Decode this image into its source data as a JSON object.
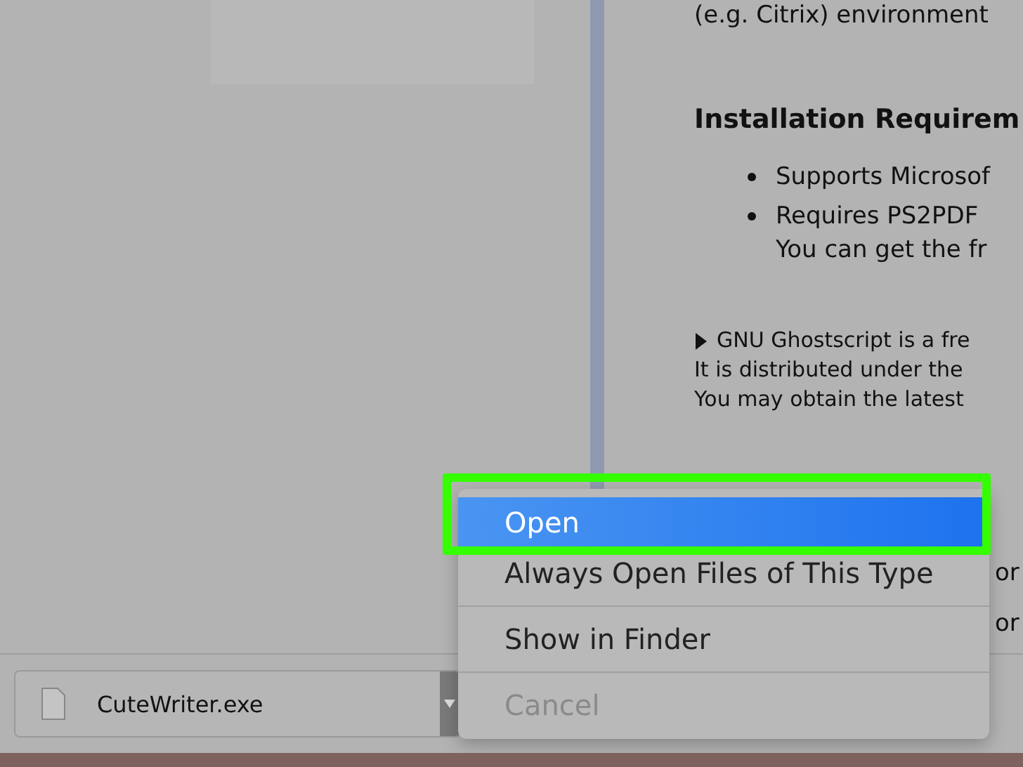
{
  "document": {
    "paragraphs": [
      {
        "kind": "text",
        "text": "(e.g. Citrix) environment"
      },
      {
        "kind": "heading",
        "text": "Installation Requirem"
      },
      {
        "kind": "bullet",
        "text": "Supports Microsof"
      },
      {
        "kind": "bullet",
        "text": "Requires PS2PDF",
        "more": "You can get the fr"
      },
      {
        "kind": "note",
        "text": "GNU Ghostscript is a fre",
        "lines": [
          "It is distributed under the",
          "You may obtain the latest"
        ]
      }
    ],
    "side_fragments": [
      "or",
      "or"
    ]
  },
  "context_menu": {
    "items": [
      {
        "label": "Open",
        "selected": true,
        "disabled": false,
        "highlighted": true
      },
      {
        "label": "Always Open Files of This Type",
        "selected": false,
        "disabled": false,
        "highlighted": false
      },
      {
        "label": "Show in Finder",
        "selected": false,
        "disabled": false,
        "highlighted": false
      },
      {
        "label": "Cancel",
        "selected": false,
        "disabled": true,
        "highlighted": false
      }
    ]
  },
  "download_bar": {
    "file_name": "CuteWriter.exe"
  }
}
